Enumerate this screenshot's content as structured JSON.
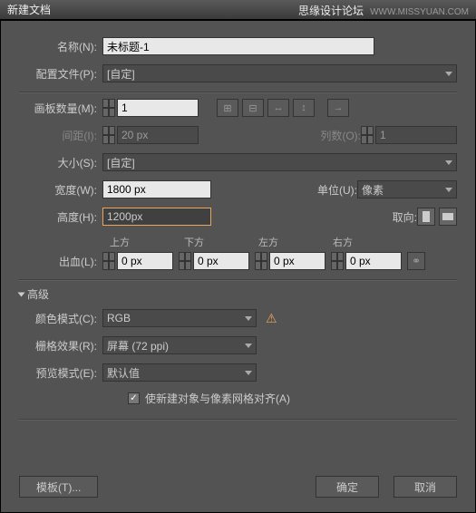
{
  "title": "新建文档",
  "watermark": {
    "text": "思缘设计论坛",
    "url": "WWW.MISSYUAN.COM"
  },
  "name": {
    "label": "名称(N):",
    "value": "未标题-1"
  },
  "profile": {
    "label": "配置文件(P):",
    "value": "[自定]"
  },
  "artboards": {
    "label": "画板数量(M):",
    "value": "1"
  },
  "spacing": {
    "label": "间距(I):",
    "value": "20 px"
  },
  "columns": {
    "label": "列数(O):",
    "value": "1"
  },
  "size": {
    "label": "大小(S):",
    "value": "[自定]"
  },
  "width": {
    "label": "宽度(W):",
    "value": "1800 px"
  },
  "units": {
    "label": "单位(U):",
    "value": "像素"
  },
  "height": {
    "label": "高度(H):",
    "value": "1200px"
  },
  "orient": {
    "label": "取向:"
  },
  "bleed": {
    "label": "出血(L):",
    "headers": {
      "top": "上方",
      "bottom": "下方",
      "left": "左方",
      "right": "右方"
    },
    "values": {
      "top": "0 px",
      "bottom": "0 px",
      "left": "0 px",
      "right": "0 px"
    }
  },
  "advanced": {
    "label": "高级"
  },
  "colorMode": {
    "label": "颜色模式(C):",
    "value": "RGB"
  },
  "raster": {
    "label": "栅格效果(R):",
    "value": "屏幕 (72 ppi)"
  },
  "preview": {
    "label": "预览模式(E):",
    "value": "默认值"
  },
  "alignGrid": {
    "label": "使新建对象与像素网格对齐(A)"
  },
  "buttons": {
    "template": "模板(T)...",
    "ok": "确定",
    "cancel": "取消"
  }
}
